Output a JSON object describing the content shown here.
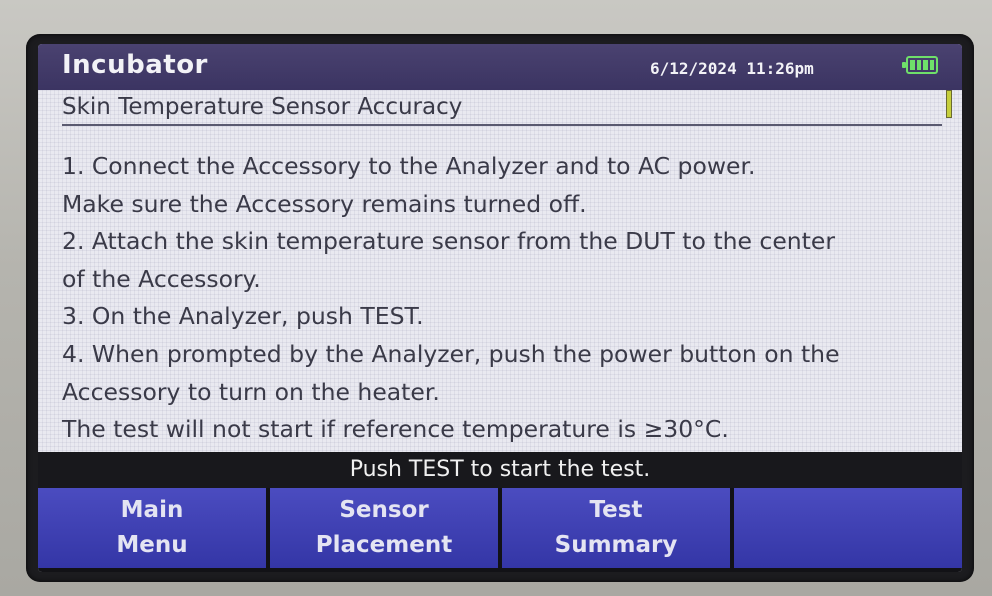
{
  "header": {
    "title": "Incubator",
    "datetime": "6/12/2024 11:26pm",
    "battery_icon": "battery-full-icon"
  },
  "screen": {
    "heading": "Skin Temperature Sensor Accuracy",
    "instruction_lines": [
      "1. Connect the Accessory to the Analyzer and to AC power.",
      "Make sure the Accessory remains turned off.",
      "2. Attach the skin temperature sensor from the DUT to the center",
      "of the Accessory.",
      "3. On the Analyzer, push TEST.",
      "4. When prompted by the Analyzer, push the power button on the",
      "Accessory to turn on the heater.",
      "The test will not start if reference temperature is ≥30°C."
    ]
  },
  "status": {
    "message": "Push TEST to start the test."
  },
  "softkeys": [
    {
      "line1": "Main",
      "line2": "Menu"
    },
    {
      "line1": "Sensor",
      "line2": "Placement"
    },
    {
      "line1": "Test",
      "line2": "Summary"
    },
    {
      "line1": "",
      "line2": ""
    }
  ],
  "colors": {
    "title_bar": "#3b3462",
    "softkey": "#3436a6",
    "battery": "#6fe06a",
    "content_bg": "#e9e9f0"
  }
}
